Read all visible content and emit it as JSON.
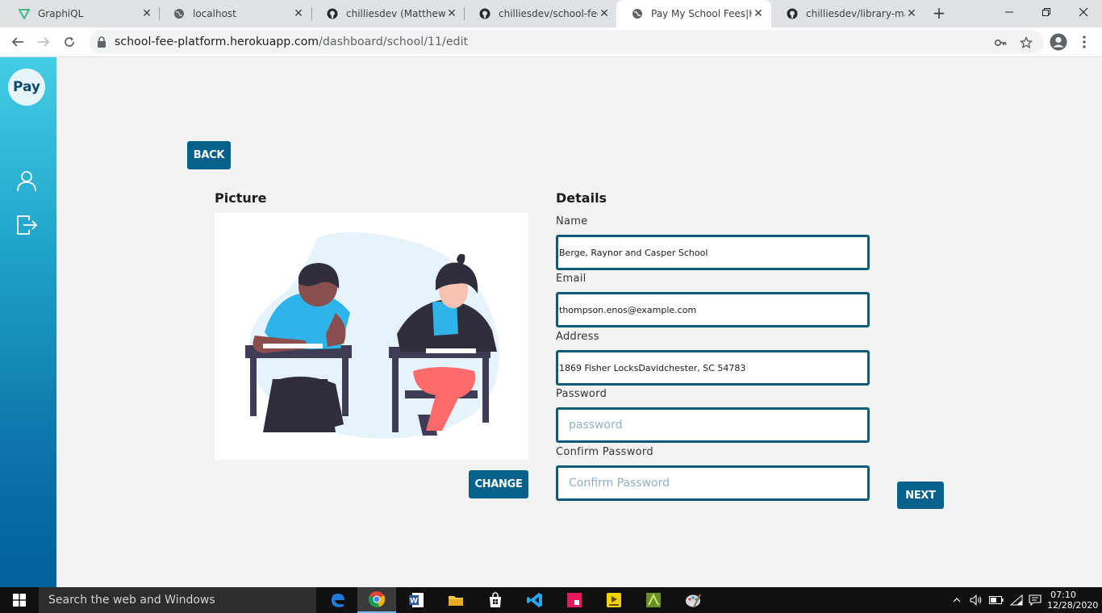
{
  "browser": {
    "tabs": [
      {
        "title": "GraphiQL",
        "favicon": "graphiql-icon"
      },
      {
        "title": "localhost",
        "favicon": "globe-icon"
      },
      {
        "title": "chilliesdev (Matthew ka",
        "favicon": "github-icon"
      },
      {
        "title": "chilliesdev/school-fee-p",
        "favicon": "github-icon"
      },
      {
        "title": "Pay My School Fees|Ho",
        "favicon": "globe-icon",
        "active": true
      },
      {
        "title": "chilliesdev/library-mana",
        "favicon": "github-icon"
      }
    ],
    "url_host": "school-fee-platform.herokuapp.com",
    "url_path": "/dashboard/school/11/edit"
  },
  "sidebar": {
    "logo_text": "Pay",
    "items": [
      {
        "icon": "user-icon"
      },
      {
        "icon": "logout-icon"
      }
    ]
  },
  "page": {
    "back_label": "BACK",
    "picture_title": "Picture",
    "change_label": "CHANGE",
    "details_title": "Details",
    "next_label": "NEXT",
    "fields": {
      "name": {
        "label": "Name",
        "value": "Berge, Raynor and Casper School"
      },
      "email": {
        "label": "Email",
        "value": "thompson.enos@example.com"
      },
      "address": {
        "label": "Address",
        "value": "1869 Fisher LocksDavidchester, SC 54783"
      },
      "password": {
        "label": "Password",
        "placeholder": "password"
      },
      "confirm_password": {
        "label": "Confirm Password",
        "placeholder": "Confirm Password"
      }
    }
  },
  "taskbar": {
    "search_placeholder": "Search the web and Windows",
    "time": "07:10",
    "date": "12/28/2020"
  },
  "colors": {
    "accent": "#04618c",
    "input_border": "#0f5a7a",
    "sidebar_top": "#44cde6",
    "sidebar_bottom": "#03609a"
  }
}
